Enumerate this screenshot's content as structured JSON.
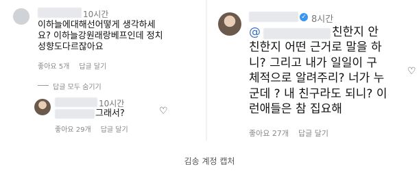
{
  "left": {
    "comment1": {
      "time": "10시간",
      "text": "이하늘에대해선어떻게 생각하세\n요? 이하늘강원래랑베프인데 정치\n성향도다르잖아요",
      "likes": "좋아요 5개",
      "reply": "답글 달기"
    },
    "hide_replies": "답글 모두 숨기기",
    "comment2": {
      "time": "10시간",
      "text": "그래서?",
      "likes": "좋아요 29개",
      "reply": "답글 달기"
    }
  },
  "right": {
    "time": "8시간",
    "mention": "@",
    "text_line1_suffix": "친한지 안",
    "text_rest": "친한지 어떤 근거로 말을 하\n니? 그리고 내가 일일이 구\n체적으로 알려주리? 너가 누\n군데 ? 내 친구라도 되니? 이\n런애들은 참 집요해",
    "likes": "좋아요 27개",
    "reply": "답글 달기"
  },
  "caption": "김송 계정 캡처",
  "icons": {
    "heart": "heart-outline-icon",
    "verified": "verified-badge-icon"
  },
  "colors": {
    "mention": "#3a6fc4",
    "verified": "#3897f0"
  }
}
